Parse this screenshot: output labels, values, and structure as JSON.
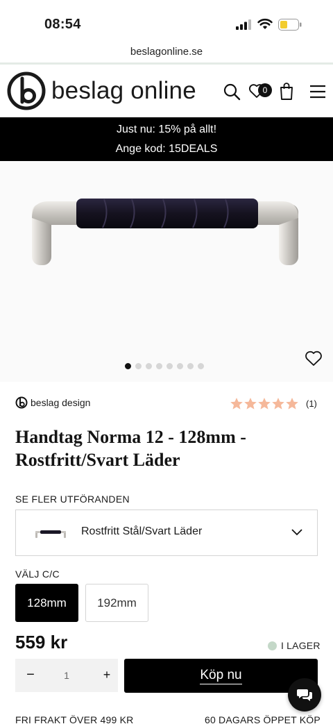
{
  "status_bar": {
    "time": "08:54",
    "icons": [
      "signal-icon",
      "wifi-icon",
      "battery-icon"
    ]
  },
  "browser": {
    "url": "beslagonline.se"
  },
  "header": {
    "logo_text": "beslag online",
    "icons": [
      "search-icon",
      "heart-icon",
      "bag-icon",
      "menu-icon"
    ],
    "wishlist_count": "0"
  },
  "promo": {
    "line1": "Just nu: 15% på allt!",
    "line2": "Ange kod: 15DEALS"
  },
  "gallery": {
    "image_count": 8,
    "active_index": 0
  },
  "product": {
    "brand": "beslag design",
    "rating": 5,
    "rating_count": "(1)",
    "title_line1": "Handtag Norma 12 - 128mm -",
    "title_line2": "Rostfritt/Svart Läder",
    "variants_label": "SE FLER UTFÖRANDEN",
    "selected_variant": "Rostfritt Stål/Svart Läder",
    "size_label": "VÄLJ C/C",
    "sizes": [
      {
        "label": "128mm",
        "selected": true
      },
      {
        "label": "192mm",
        "selected": false
      }
    ],
    "price": "559 kr",
    "stock": "I LAGER",
    "quantity": "1",
    "qty_minus": "−",
    "qty_plus": "+",
    "buy_label": "Köp nu"
  },
  "footer": {
    "left": "FRI FRAKT ÖVER 499 KR",
    "right": "60 DAGARS ÖPPET KÖP"
  },
  "colors": {
    "accent": "#000000",
    "star": "#f5b89a",
    "stock_dot": "#c4d8c8"
  }
}
